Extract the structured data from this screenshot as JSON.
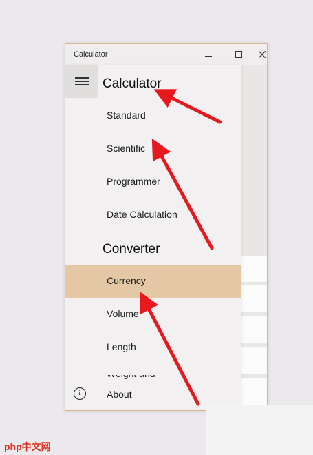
{
  "window": {
    "title": "Calculator"
  },
  "nav": {
    "calculator_heading": "Calculator",
    "calculator_items": [
      {
        "label": "Standard"
      },
      {
        "label": "Scientific"
      },
      {
        "label": "Programmer"
      },
      {
        "label": "Date Calculation"
      }
    ],
    "converter_heading": "Converter",
    "converter_items": [
      {
        "label": "Currency",
        "selected": true
      },
      {
        "label": "Volume"
      },
      {
        "label": "Length"
      }
    ],
    "partial_item": "Weight and Mass",
    "about_label": "About"
  },
  "icons": {
    "menu": "hamburger-icon",
    "minimize": "minimize-icon",
    "maximize": "maximize-icon",
    "close": "close-icon",
    "info": "info-icon"
  },
  "colors": {
    "selected_item": "#e4c8a6",
    "arrow": "#e5191e",
    "window_border": "#d7b88c"
  },
  "watermark": "php中文网"
}
